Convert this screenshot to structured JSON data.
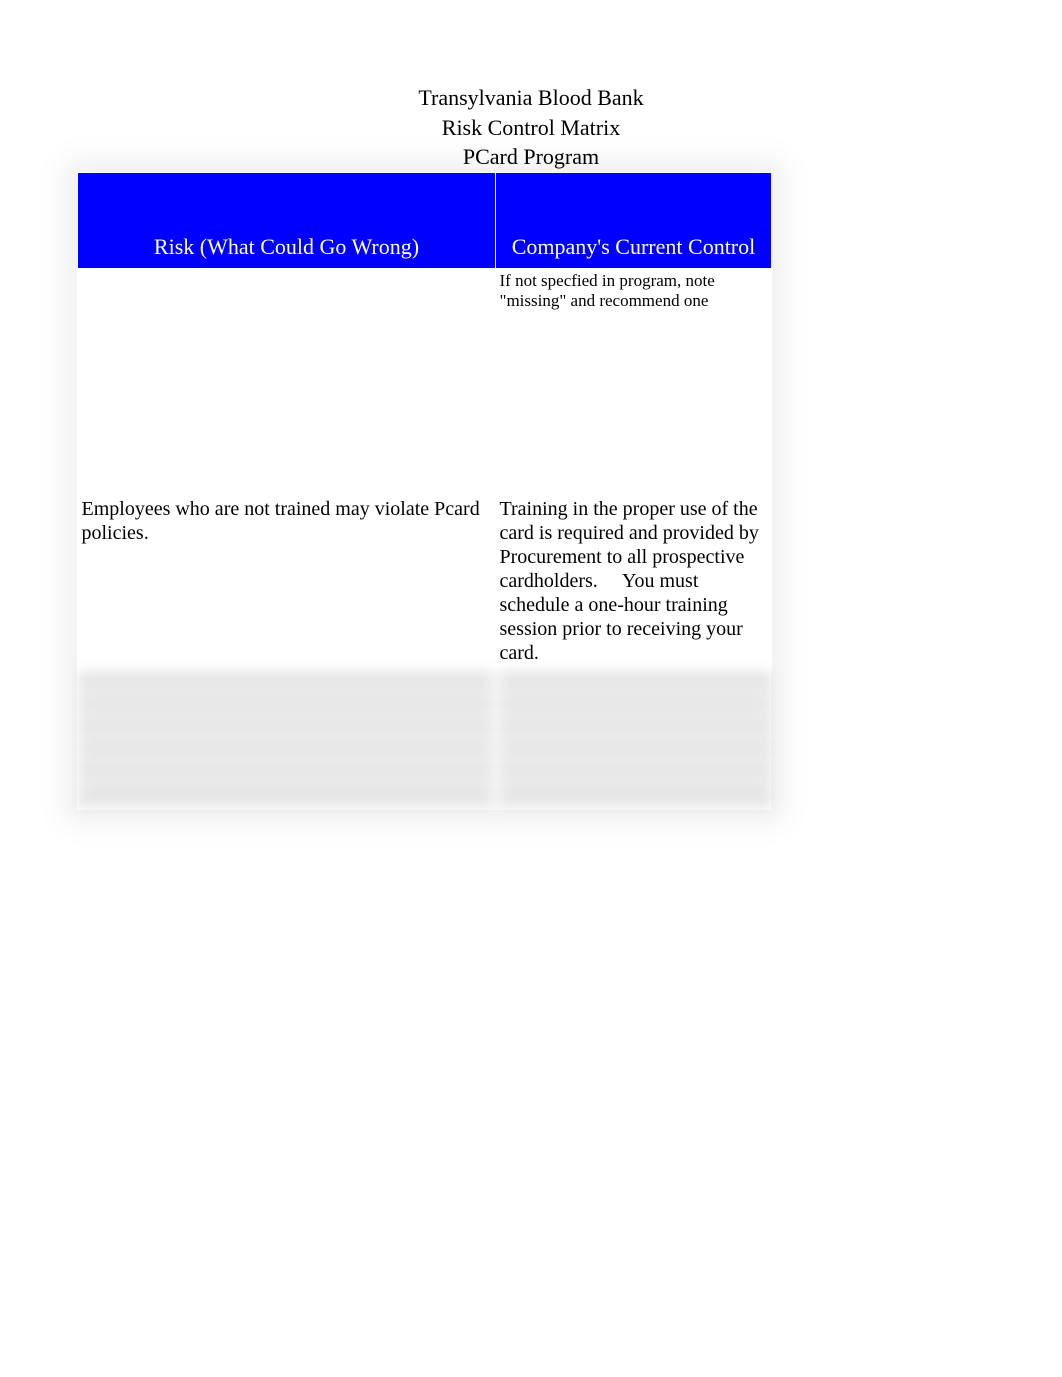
{
  "header": {
    "line1": "Transylvania Blood Bank",
    "line2": "Risk Control Matrix",
    "line3": "PCard Program"
  },
  "table": {
    "columns": {
      "risk": "Risk (What Could Go Wrong)",
      "control": "Company's Current Control"
    },
    "note_row": {
      "risk": "",
      "control": "If not specfied in program, note \"missing\" and recommend one"
    },
    "data_row": {
      "risk": "Employees who are not trained may violate Pcard policies.",
      "control": "Training in the proper use of the card is required and provided by Procurement to all prospective cardholders.  You must schedule a one-hour training session prior to receiving your card."
    }
  }
}
